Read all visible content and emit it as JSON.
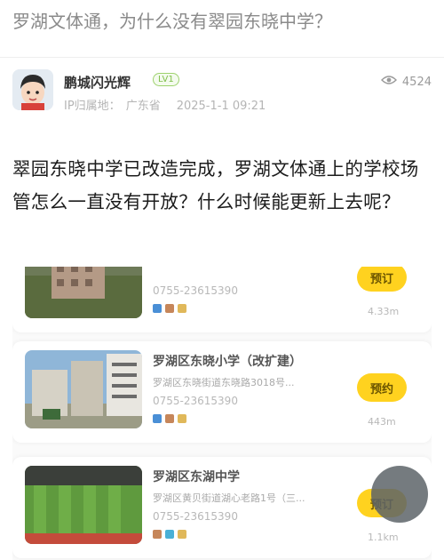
{
  "page": {
    "title": "罗湖文体通，为什么没有翠园东晓中学？"
  },
  "author": {
    "name": "鹏城闪光辉",
    "level": "LV1",
    "ip_location": "IP归属地：",
    "province": "广东省",
    "timestamp": "2025-1-1 09:21",
    "view_count": "4524"
  },
  "post": {
    "body": "翠园东晓中学已改造完成，罗湖文体通上的学校场管怎么一直没有开放？什么时候能更新上去呢？"
  },
  "screenshot": {
    "cards": [
      {
        "name": "",
        "address": "",
        "phone": "0755-23615390",
        "book_label": "预订",
        "distance": "4.33m"
      },
      {
        "name": "罗湖区东晓小学（改扩建）",
        "address": "罗湖区东晓街道东晓路3018号...",
        "phone": "0755-23615390",
        "book_label": "预约",
        "distance": "443m"
      },
      {
        "name": "罗湖区东湖中学",
        "address": "罗湖区黄贝街道湖心老路1号（三...",
        "phone": "0755-23615390",
        "book_label": "预订",
        "distance": "1.1km"
      }
    ]
  }
}
